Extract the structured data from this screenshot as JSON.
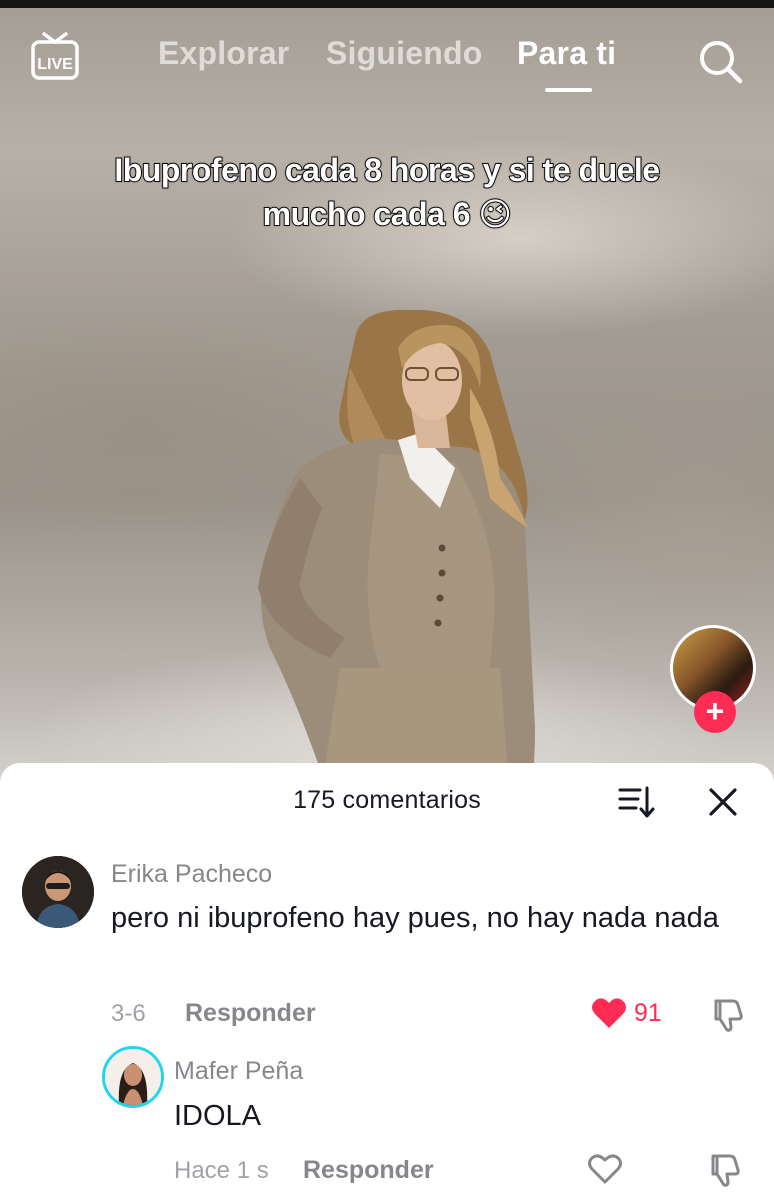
{
  "topnav": {
    "live_icon": "live-tv-icon",
    "tabs": [
      {
        "label": "Explorar",
        "active": false
      },
      {
        "label": "Siguiendo",
        "active": false
      },
      {
        "label": "Para ti",
        "active": true
      }
    ],
    "search_icon": "search-icon"
  },
  "video": {
    "caption_line1": "Ibuprofeno cada 8 horas y si te duele",
    "caption_line2": "mucho cada 6 😉",
    "follow_icon": "plus-icon"
  },
  "comments_sheet": {
    "title": "175 comentarios",
    "sort_icon": "sort-icon",
    "close_icon": "close-icon",
    "comments": [
      {
        "author": "Erika Pacheco",
        "text": "pero ni ibuprofeno hay pues, no hay nada nada",
        "time": "3-6",
        "reply_label": "Responder",
        "likes": "91",
        "liked": true
      },
      {
        "author": "Mafer Peña",
        "text": "IDOLA",
        "time": "Hace 1 s",
        "reply_label": "Responder",
        "likes": "",
        "liked": false
      }
    ]
  },
  "colors": {
    "accent": "#fe2c55",
    "story_ring": "#20d5ec",
    "text_primary": "#161823",
    "text_secondary": "#86878b"
  }
}
